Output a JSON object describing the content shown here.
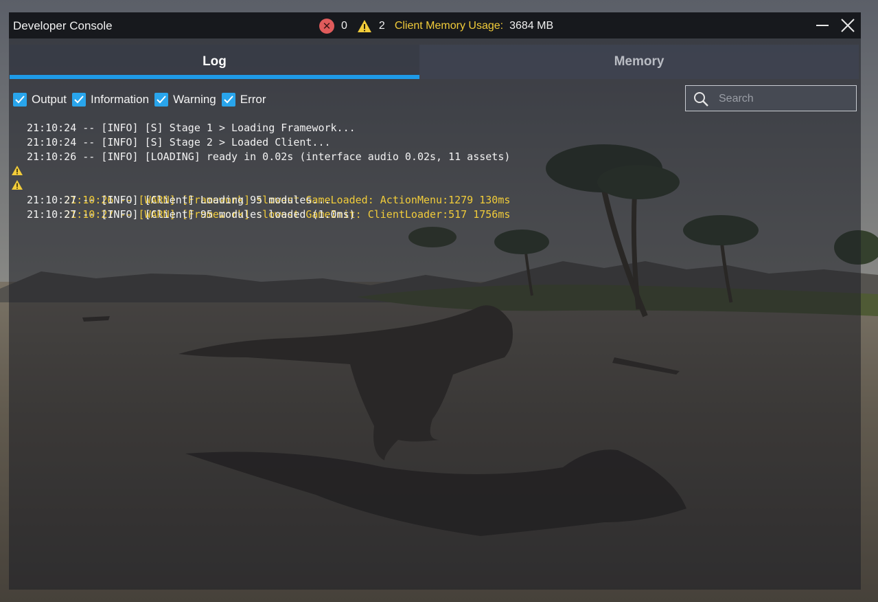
{
  "window": {
    "title": "Developer Console",
    "minimize_icon": "minimize-icon",
    "close_icon": "close-icon"
  },
  "stats": {
    "error_count": "0",
    "warning_count": "2",
    "memory_label": "Client Memory Usage:",
    "memory_value": "3684 MB",
    "error_icon": "error-circle-icon",
    "warning_icon": "warning-triangle-icon"
  },
  "tabs": [
    {
      "label": "Log",
      "active": true
    },
    {
      "label": "Memory",
      "active": false
    }
  ],
  "filters": [
    {
      "label": "Output",
      "checked": true
    },
    {
      "label": "Information",
      "checked": true
    },
    {
      "label": "Warning",
      "checked": true
    },
    {
      "label": "Error",
      "checked": true
    }
  ],
  "search": {
    "placeholder": "Search",
    "value": ""
  },
  "log": [
    {
      "level": "info",
      "text": "21:10:24 -- [INFO] [S] Stage 1 > Loading Framework..."
    },
    {
      "level": "info",
      "text": "21:10:24 -- [INFO] [S] Stage 2 > Loaded Client..."
    },
    {
      "level": "info",
      "text": "21:10:26 -- [INFO] [LOADING] ready in 0.02s (interface audio 0.02s, 11 assets)"
    },
    {
      "level": "warn",
      "text": "21:10:26 -- [WARN] [Framework] slowest GameLoaded: ActionMenu:1279 130ms"
    },
    {
      "level": "warn",
      "text": "21:10:27 -- [WARN] [Framework] slowest GameInit: ClientLoader:517 1756ms"
    },
    {
      "level": "info",
      "text": "21:10:27 -- [INFO] [Client] Loading 95 modules..."
    },
    {
      "level": "info",
      "text": "21:10:27 -- [INFO] [Client] 95 modules loaded (1.0ms)"
    }
  ],
  "colors": {
    "accent": "#1e9be8",
    "warning": "#f2cc3a",
    "error": "#e05b5b",
    "checkbox": "#29a5ec"
  }
}
